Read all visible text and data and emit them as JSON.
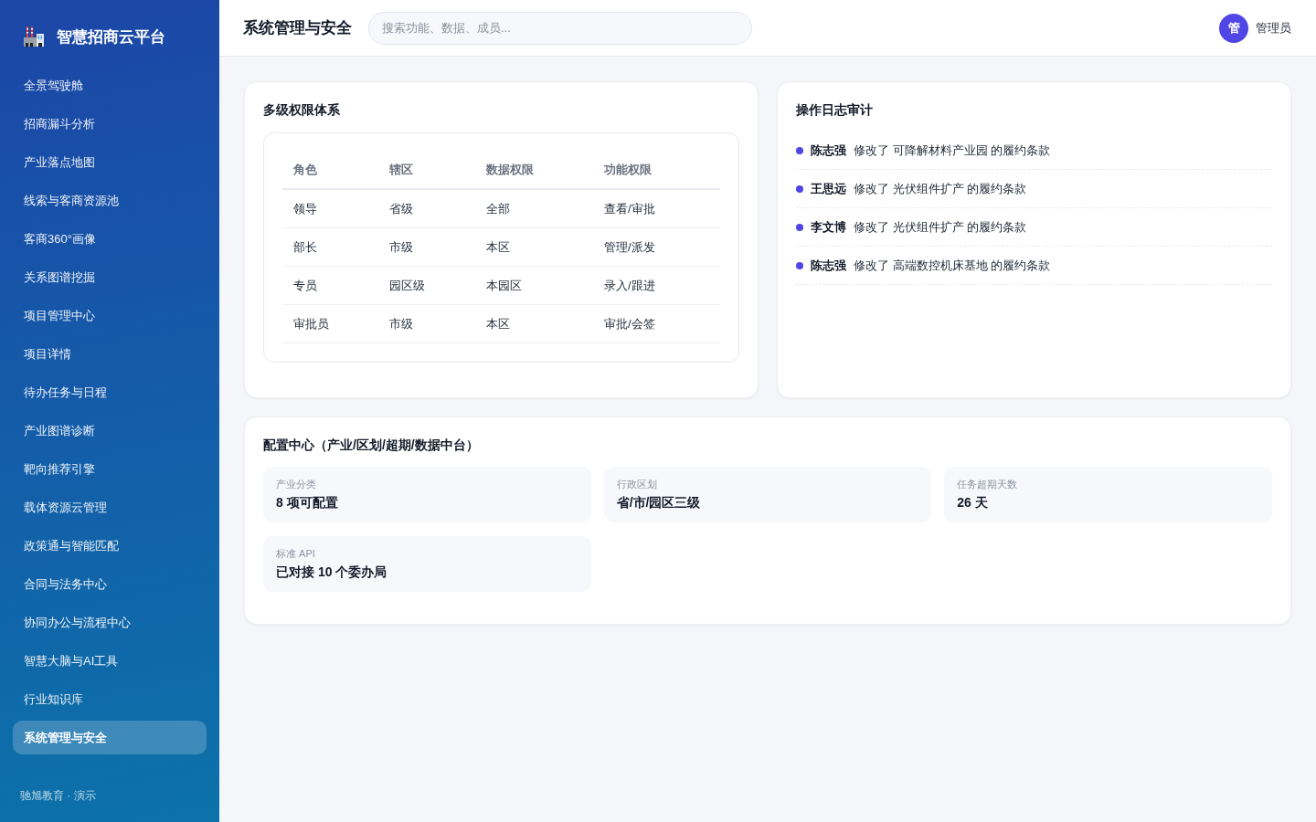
{
  "sidebar": {
    "logo": {
      "title": "智慧招商云平台"
    },
    "items": [
      {
        "label": "全景驾驶舱",
        "selected": false
      },
      {
        "label": "招商漏斗分析",
        "selected": false
      },
      {
        "label": "产业落点地图",
        "selected": false
      },
      {
        "label": "线索与客商资源池",
        "selected": false
      },
      {
        "label": "客商360°画像",
        "selected": false
      },
      {
        "label": "关系图谱挖掘",
        "selected": false
      },
      {
        "label": "项目管理中心",
        "selected": false
      },
      {
        "label": "项目详情",
        "selected": false
      },
      {
        "label": "待办任务与日程",
        "selected": false
      },
      {
        "label": "产业图谱诊断",
        "selected": false
      },
      {
        "label": "靶向推荐引擎",
        "selected": false
      },
      {
        "label": "载体资源云管理",
        "selected": false
      },
      {
        "label": "政策通与智能匹配",
        "selected": false
      },
      {
        "label": "合同与法务中心",
        "selected": false
      },
      {
        "label": "协同办公与流程中心",
        "selected": false
      },
      {
        "label": "智慧大脑与AI工具",
        "selected": false
      },
      {
        "label": "行业知识库",
        "selected": false
      },
      {
        "label": "系统管理与安全",
        "selected": true
      }
    ],
    "footer": "驰旭教育 · 演示"
  },
  "header": {
    "title": "系统管理与安全",
    "search": {
      "placeholder": "搜索功能、数据、成员..."
    },
    "user": {
      "avatar": "管",
      "name": "管理员"
    }
  },
  "permissions": {
    "title": "多级权限体系",
    "table": {
      "columns": [
        "角色",
        "辖区",
        "数据权限",
        "功能权限"
      ],
      "rows": [
        [
          "领导",
          "省级",
          "全部",
          "查看/审批"
        ],
        [
          "部长",
          "市级",
          "本区",
          "管理/派发"
        ],
        [
          "专员",
          "园区级",
          "本园区",
          "录入/跟进"
        ],
        [
          "审批员",
          "市级",
          "本区",
          "审批/会签"
        ]
      ]
    }
  },
  "audit_log": {
    "title": "操作日志审计",
    "entries": [
      {
        "user": "陈志强",
        "message": "修改了 可降解材料产业园 的履约条款"
      },
      {
        "user": "王思远",
        "message": "修改了 光伏组件扩产 的履约条款"
      },
      {
        "user": "李文博",
        "message": "修改了 光伏组件扩产 的履约条款"
      },
      {
        "user": "陈志强",
        "message": "修改了 高端数控机床基地 的履约条款"
      }
    ]
  },
  "config_center": {
    "title": "配置中心（产业/区划/超期/数据中台）",
    "items": [
      {
        "label": "产业分类",
        "value": "8 项可配置"
      },
      {
        "label": "行政区划",
        "value": "省/市/园区三级"
      },
      {
        "label": "任务超期天数",
        "value": "26 天"
      },
      {
        "label": "标准 API",
        "value": "已对接 10 个委办局"
      }
    ]
  }
}
